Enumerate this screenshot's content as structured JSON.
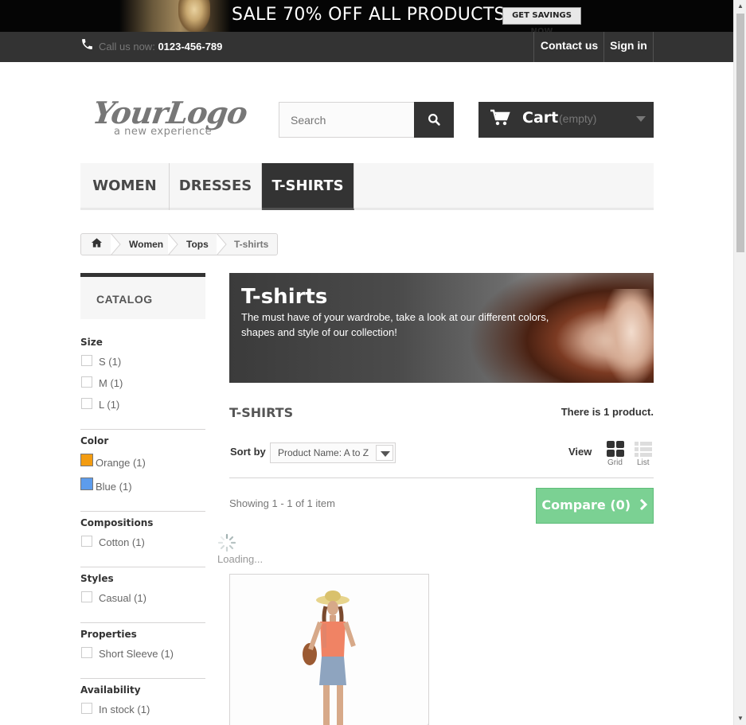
{
  "promo": {
    "sale_text": "SALE 70% OFF ALL PRODUCTS",
    "button_label": "GET SAVINGS NOW"
  },
  "topnav": {
    "call_label": "Call us now:",
    "phone": "0123-456-789",
    "contact": "Contact us",
    "signin": "Sign in"
  },
  "logo": {
    "main": "YourLogo",
    "tagline": "a new experience"
  },
  "search": {
    "placeholder": "Search"
  },
  "cart": {
    "label": "Cart",
    "status": "(empty)"
  },
  "menu": {
    "items": [
      "WOMEN",
      "DRESSES",
      "T-SHIRTS"
    ],
    "active": "T-SHIRTS"
  },
  "breadcrumb": {
    "items": [
      "Women",
      "Tops",
      "T-shirts"
    ]
  },
  "sidebar": {
    "title": "CATALOG",
    "facets": [
      {
        "title": "Size",
        "options": [
          "S (1)",
          "M (1)",
          "L (1)"
        ]
      },
      {
        "title": "Color",
        "options": [
          {
            "label": "Orange (1)",
            "color": "#f39c11"
          },
          {
            "label": "Blue (1)",
            "color": "#5d9cec"
          }
        ]
      },
      {
        "title": "Compositions",
        "options": [
          "Cotton (1)"
        ]
      },
      {
        "title": "Styles",
        "options": [
          "Casual (1)"
        ]
      },
      {
        "title": "Properties",
        "options": [
          "Short Sleeve (1)"
        ]
      },
      {
        "title": "Availability",
        "options": [
          "In stock (1)"
        ]
      }
    ]
  },
  "category": {
    "banner_title": "T-shirts",
    "banner_text": "The must have of your wardrobe, take a look at our different colors, shapes and style of our collection!",
    "heading": "T-SHIRTS",
    "product_count": "There is 1 product.",
    "sort_label": "Sort by",
    "sort_value": "Product Name: A to Z",
    "view_label": "View",
    "view_grid": "Grid",
    "view_list": "List",
    "showing": "Showing 1 - 1 of 1 item",
    "compare": "Compare (0)",
    "loading": "Loading..."
  },
  "colors": {
    "dark": "#333333",
    "compare_green": "#7bd193",
    "accent_orange": "#f39c11",
    "accent_blue": "#5d9cec"
  }
}
